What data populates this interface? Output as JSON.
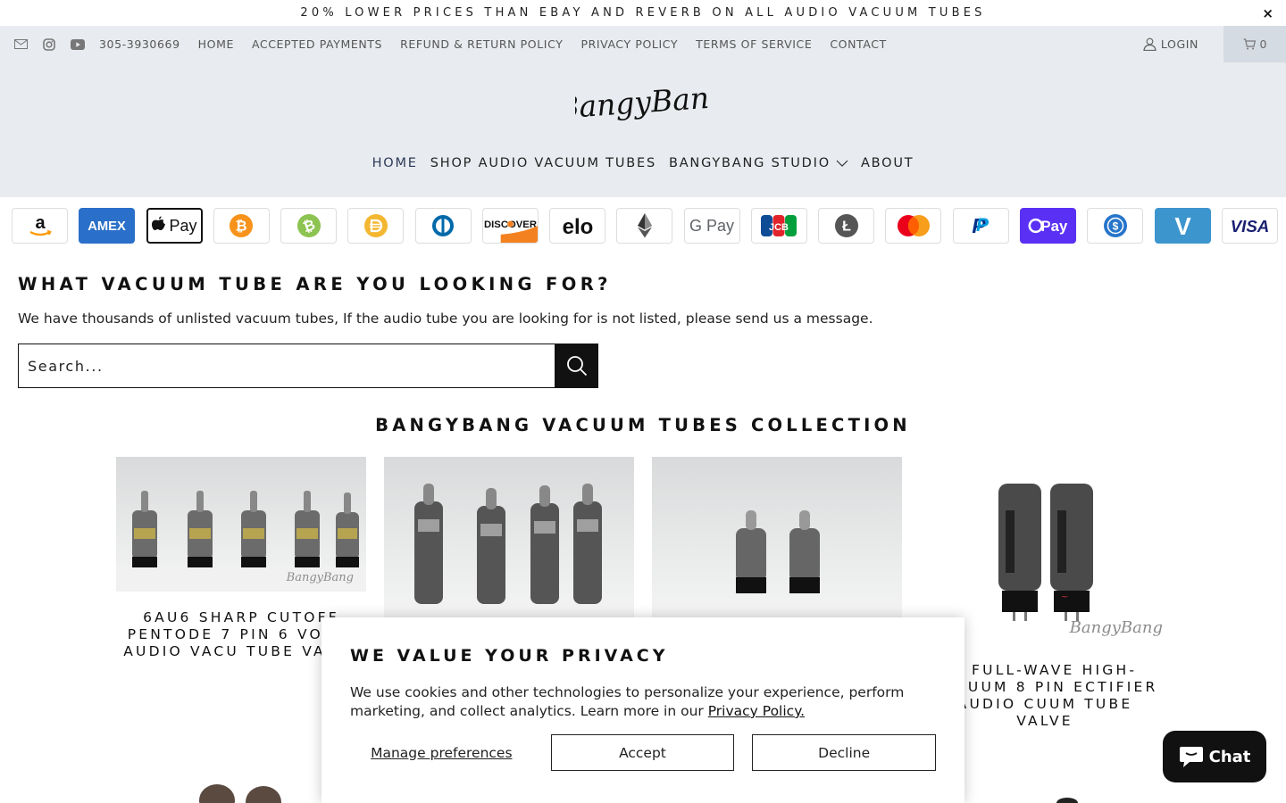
{
  "announcement": {
    "text": "20% LOWER PRICES THAN EBAY AND REVERB ON ALL AUDIO VACUUM TUBES",
    "close": "×"
  },
  "topbar": {
    "icons": [
      "mail-icon",
      "instagram-icon",
      "youtube-icon"
    ],
    "phone": "305-3930669",
    "links": [
      "HOME",
      "ACCEPTED PAYMENTS",
      "REFUND & RETURN POLICY",
      "PRIVACY POLICY",
      "TERMS OF SERVICE",
      "CONTACT"
    ],
    "login": "LOGIN",
    "cart_count": "0"
  },
  "header": {
    "logo": "BangyBang",
    "nav": [
      "HOME",
      "SHOP AUDIO VACUUM TUBES",
      "BANGYBANG STUDIO",
      "ABOUT"
    ]
  },
  "payments": [
    "amazon",
    "amex",
    "apple-pay",
    "bitcoin",
    "bitcoin-cash",
    "dai",
    "diners-club",
    "discover",
    "elo",
    "ethereum",
    "google-pay",
    "jcb",
    "litecoin",
    "mastercard",
    "paypal",
    "shop-pay",
    "usdc",
    "venmo",
    "visa"
  ],
  "payment_labels": {
    "amex": "AMEX",
    "apple": "Pay",
    "discover": "DISCOVER",
    "elo": "elo",
    "gpay": "G Pay",
    "jcb": "JCB",
    "paypal": "P",
    "shoppay": "Pay",
    "visa": "VISA",
    "venmo": "V",
    "amazon": "a"
  },
  "search": {
    "title": "WHAT VACUUM TUBE ARE YOU LOOKING FOR?",
    "description": "We have thousands of unlisted vacuum tubes, If the audio tube you are looking for is not listed, please send us a message.",
    "placeholder": "Search..."
  },
  "collection": {
    "title": "BANGYBANG VACUUM TUBES COLLECTION",
    "products": [
      {
        "name": "6AU6 SHARP CUTOFF PENTODE 7 PIN 6.3 VOLTS AUDIO VACUUM TUBE VALVE",
        "visible_name": "6AU6 SHARP CUTOFF PENTODE 7 PIN 6 VOLTS AUDIO VACU TUBE VALVE"
      },
      {
        "name": ""
      },
      {
        "name": ""
      },
      {
        "name": "4 FULL-WAVE HIGH- VACUUM 8 PIN ECTIFIER AUDIO CUUM TUBE VALVE"
      }
    ],
    "watermark": "BangyBang"
  },
  "privacy": {
    "title": "WE VALUE YOUR PRIVACY",
    "text": "We use cookies and other technologies to personalize your experience, perform marketing, and collect analytics. Learn more in our",
    "link": "Privacy Policy.",
    "manage": "Manage preferences",
    "accept": "Accept",
    "decline": "Decline"
  },
  "chat": {
    "label": "Chat"
  }
}
